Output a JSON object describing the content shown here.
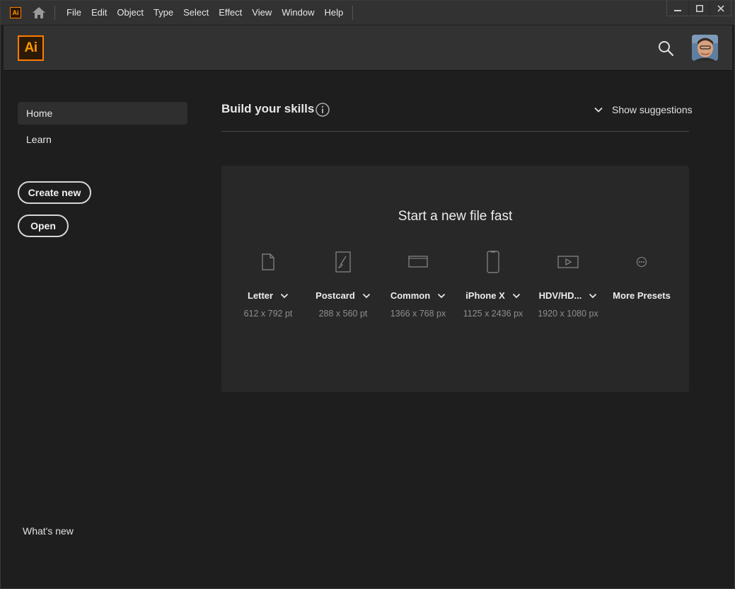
{
  "menubar": {
    "app_badge": "Ai",
    "items": [
      "File",
      "Edit",
      "Object",
      "Type",
      "Select",
      "Effect",
      "View",
      "Window",
      "Help"
    ]
  },
  "header": {
    "logo_text": "Ai",
    "search_icon": "search-icon",
    "brand_color": "#ff7c00"
  },
  "sidebar": {
    "nav": [
      {
        "label": "Home",
        "active": true
      },
      {
        "label": "Learn",
        "active": false
      }
    ],
    "create_new_label": "Create new",
    "open_label": "Open",
    "whats_new_label": "What's new"
  },
  "skills": {
    "title": "Build your skills",
    "show_suggestions_label": "Show suggestions"
  },
  "new_file": {
    "title": "Start a new file fast",
    "presets": [
      {
        "label": "Letter",
        "size": "612 x 792 pt",
        "icon": "document-icon",
        "has_dropdown": true
      },
      {
        "label": "Postcard",
        "size": "288 x 560 pt",
        "icon": "postcard-brush-icon",
        "has_dropdown": true
      },
      {
        "label": "Common",
        "size": "1366 x 768 px",
        "icon": "monitor-icon",
        "has_dropdown": true
      },
      {
        "label": "iPhone X",
        "size": "1125 x 2436 px",
        "icon": "phone-icon",
        "has_dropdown": true
      },
      {
        "label": "HDV/HD...",
        "size": "1920 x 1080 px",
        "icon": "video-play-icon",
        "has_dropdown": true
      },
      {
        "label": "More Presets",
        "size": "",
        "icon": "more-ellipsis-icon",
        "has_dropdown": false
      }
    ]
  }
}
